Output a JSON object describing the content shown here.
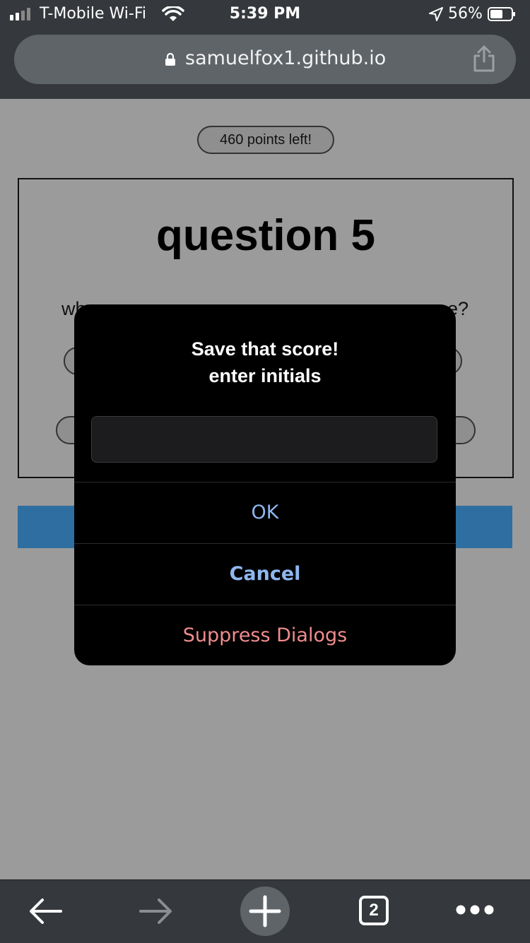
{
  "status": {
    "carrier": "T-Mobile Wi-Fi",
    "time": "5:39 PM",
    "battery": "56%"
  },
  "browser": {
    "url": "samuelfox1.github.io",
    "tab_count": "2"
  },
  "page": {
    "points": "460 points left!",
    "question_title": "question 5",
    "question_start": "wh",
    "question_end": "e?"
  },
  "dialog": {
    "title": "Save that score!",
    "subtitle": "enter initials",
    "input_value": "",
    "ok": "OK",
    "cancel": "Cancel",
    "suppress": "Suppress Dialogs"
  },
  "colors": {
    "accent_blue": "#8fb7ef",
    "destructive": "#f08c8c",
    "page_bar": "#2e6ea0"
  }
}
